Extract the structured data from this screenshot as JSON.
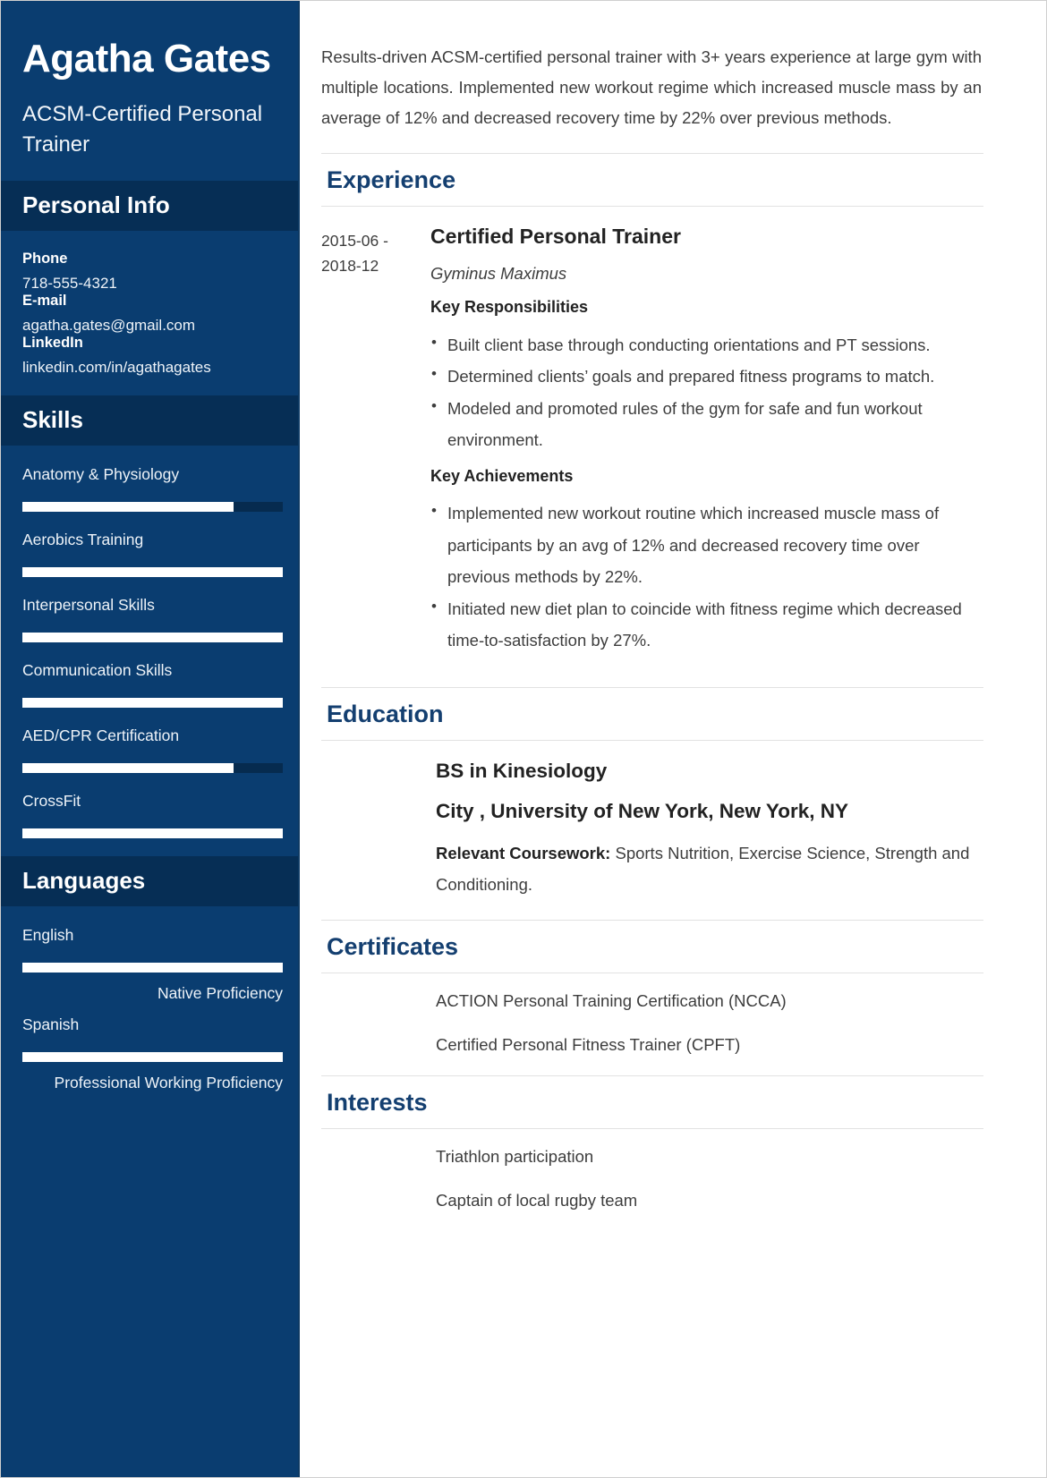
{
  "theme": {
    "sidebar_bg": "#0a3d70",
    "sidebar_header_bg": "#062e55",
    "accent": "#143f70",
    "bar_fill": "#ffffff",
    "bar_track": "#062b4f",
    "text": "#3d3d3d"
  },
  "sidebar": {
    "name": "Agatha Gates",
    "job_title": "ACSM-Certified Personal Trainer",
    "personal_info": {
      "heading": "Personal Info",
      "fields": [
        {
          "label": "Phone",
          "value": "718-555-4321"
        },
        {
          "label": "E-mail",
          "value": "agatha.gates@gmail.com"
        },
        {
          "label": "LinkedIn",
          "value": "linkedin.com/in/agathagates"
        }
      ]
    },
    "skills": {
      "heading": "Skills",
      "items": [
        {
          "name": "Anatomy & Physiology",
          "level": 81
        },
        {
          "name": "Aerobics Training",
          "level": 100
        },
        {
          "name": "Interpersonal Skills",
          "level": 100
        },
        {
          "name": "Communication Skills",
          "level": 100
        },
        {
          "name": "AED/CPR Certification",
          "level": 81
        },
        {
          "name": "CrossFit",
          "level": 100
        }
      ]
    },
    "languages": {
      "heading": "Languages",
      "items": [
        {
          "name": "English",
          "level": 100,
          "proficiency": "Native Proficiency"
        },
        {
          "name": "Spanish",
          "level": 100,
          "proficiency": "Professional Working Proficiency"
        }
      ]
    }
  },
  "main": {
    "summary": "Results-driven ACSM-certified personal trainer with 3+ years experience at large gym with multiple locations. Implemented new workout regime which increased muscle mass by an average of 12% and decreased recovery time by 22% over previous methods.",
    "experience": {
      "heading": "Experience",
      "entries": [
        {
          "date": "2015-06 - 2018-12",
          "role": "Certified Personal Trainer",
          "company": "Gyminus Maximus",
          "responsibilities_heading": "Key Responsibilities",
          "responsibilities": [
            "Built client base through conducting orientations and PT sessions.",
            "Determined clients’ goals and prepared fitness programs to match.",
            "Modeled and promoted rules of the gym for safe and fun workout environment."
          ],
          "achievements_heading": "Key Achievements",
          "achievements": [
            "Implemented new workout routine which increased muscle mass of participants by an avg of 12% and decreased recovery time over previous methods by 22%.",
            "Initiated new diet plan to coincide with fitness regime which decreased time-to-satisfaction by 27%."
          ]
        }
      ]
    },
    "education": {
      "heading": "Education",
      "degree": "BS in Kinesiology",
      "school": "City , University of New York, New York, NY",
      "coursework_label": "Relevant Coursework:",
      "coursework": " Sports Nutrition, Exercise Science, Strength and Conditioning."
    },
    "certificates": {
      "heading": "Certificates",
      "items": [
        "ACTION Personal Training Certification (NCCA)",
        "Certified Personal Fitness Trainer (CPFT)"
      ]
    },
    "interests": {
      "heading": "Interests",
      "items": [
        "Triathlon participation",
        "Captain of local rugby team"
      ]
    }
  }
}
